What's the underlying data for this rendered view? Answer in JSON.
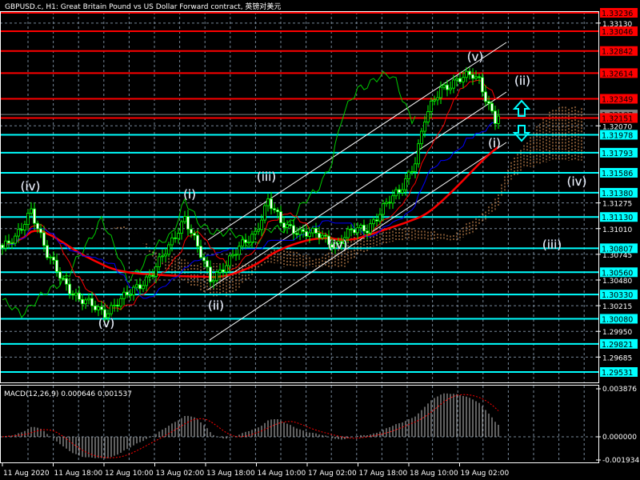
{
  "header": {
    "title": "GBPUSD.c, H1:  Great Britain Pound vs US Dollar Forward contract, 英镑对美元"
  },
  "colors": {
    "background": "#000000",
    "resistance": "#ff0000",
    "support": "#00ffff",
    "candle": "#00ff00",
    "tenkan": "#ff0000",
    "kijun": "#0000ff",
    "chikou": "#00cc00",
    "cloud": "#f4a460",
    "channel": "#ffffff",
    "grid": "#778899"
  },
  "chart_data": {
    "type": "candlestick",
    "symbol": "GBPUSD.c",
    "timeframe": "H1",
    "ylim": [
      1.29531,
      1.33236
    ],
    "price_anchors": [
      [
        0,
        1.3081
      ],
      [
        4,
        1.30892
      ],
      [
        9,
        1.31223
      ],
      [
        14,
        1.30727
      ],
      [
        19,
        1.3048
      ],
      [
        24,
        1.30274
      ],
      [
        32,
        1.3015
      ],
      [
        39,
        1.30315
      ],
      [
        47,
        1.30562
      ],
      [
        52,
        1.3081
      ],
      [
        57,
        1.3114
      ],
      [
        60,
        1.30892
      ],
      [
        65,
        1.3048
      ],
      [
        72,
        1.30727
      ],
      [
        79,
        1.30975
      ],
      [
        83,
        1.31305
      ],
      [
        87,
        1.31058
      ],
      [
        94,
        1.30975
      ],
      [
        99,
        1.30934
      ],
      [
        104,
        1.30851
      ],
      [
        109,
        1.30975
      ],
      [
        114,
        1.31016
      ],
      [
        119,
        1.31223
      ],
      [
        124,
        1.31388
      ],
      [
        129,
        1.31718
      ],
      [
        132,
        1.3213
      ],
      [
        137,
        1.3246
      ],
      [
        142,
        1.32543
      ],
      [
        147,
        1.32584
      ],
      [
        149,
        1.32543
      ],
      [
        152,
        1.32295
      ],
      [
        154,
        1.3213
      ],
      [
        155,
        1.32171
      ]
    ],
    "current_price": "1.32187",
    "resistance_levels": [
      "1.33236",
      "1.33046",
      "1.32842",
      "1.32614",
      "1.32349",
      "1.32151"
    ],
    "support_levels": [
      "1.31978",
      "1.31793",
      "1.31586",
      "1.31380",
      "1.31130",
      "1.30807",
      "1.30560",
      "1.30330",
      "1.30080",
      "1.29821",
      "1.29531"
    ],
    "price_scale_ticks": [
      "1.33130",
      "1.32070",
      "1.31275",
      "1.31010",
      "1.30745",
      "1.30480",
      "1.30215",
      "1.29950",
      "1.29685"
    ],
    "time_ticks": [
      "11 Aug 2020",
      "11 Aug 18:00",
      "12 Aug 10:00",
      "13 Aug 02:00",
      "13 Aug 18:00",
      "14 Aug 10:00",
      "17 Aug 02:00",
      "17 Aug 18:00",
      "18 Aug 10:00",
      "19 Aug 02:00"
    ],
    "wave_labels": [
      {
        "text": "(iv)",
        "bar": 9
      },
      {
        "text": "(v)",
        "bar": 32
      },
      {
        "text": "(i)",
        "bar": 58
      },
      {
        "text": "(ii)",
        "bar": 66
      },
      {
        "text": "(iii)",
        "bar": 82
      },
      {
        "text": "(iv)",
        "bar": 104
      },
      {
        "text": "(v)",
        "bar": 147
      },
      {
        "text": "(ii)",
        "bar": 162
      },
      {
        "text": "(i)",
        "bar": 153
      },
      {
        "text": "(iv)",
        "bar": 179
      },
      {
        "text": "(iii)",
        "bar": 171
      }
    ],
    "macd": {
      "label": "MACD(12,26,9) 0.000646 0.001537",
      "params": [
        12,
        26,
        9
      ],
      "value": 0.000646,
      "signal": 0.001537,
      "ylim": [
        -0.001934,
        0.003876
      ],
      "ticks": [
        "0.003876",
        "0.000000",
        "-0.001934"
      ]
    }
  }
}
